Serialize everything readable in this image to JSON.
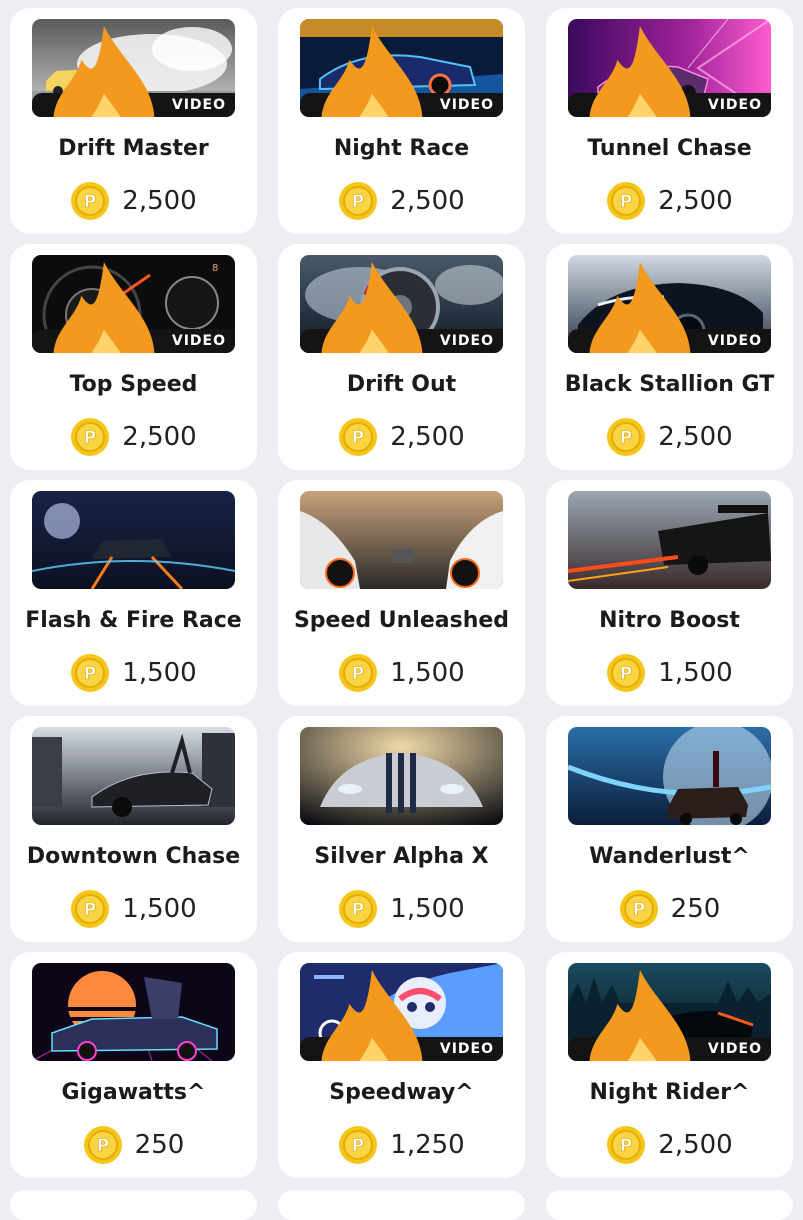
{
  "colors": {
    "card_bg": "#ffffff",
    "page_bg": "#eeeef2",
    "coin_gold": "#f5c518",
    "badge_bg": "#141414"
  },
  "items": [
    {
      "title": "Drift Master",
      "price": "2,500",
      "video": true,
      "badge": "VIDEO",
      "theme": "drift"
    },
    {
      "title": "Night Race",
      "price": "2,500",
      "video": true,
      "badge": "VIDEO",
      "theme": "neon-blue"
    },
    {
      "title": "Tunnel Chase",
      "price": "2,500",
      "video": true,
      "badge": "VIDEO",
      "theme": "tunnel"
    },
    {
      "title": "Top Speed",
      "price": "2,500",
      "video": true,
      "badge": "VIDEO",
      "theme": "gauge"
    },
    {
      "title": "Drift Out",
      "price": "2,500",
      "video": true,
      "badge": "VIDEO",
      "theme": "wheel"
    },
    {
      "title": "Black Stallion GT",
      "price": "2,500",
      "video": true,
      "badge": "VIDEO",
      "theme": "dark-car"
    },
    {
      "title": "Flash & Fire Race",
      "price": "1,500",
      "video": false,
      "badge": "",
      "theme": "fire-race"
    },
    {
      "title": "Speed Unleashed",
      "price": "1,500",
      "video": false,
      "badge": "",
      "theme": "street"
    },
    {
      "title": "Nitro Boost",
      "price": "1,500",
      "video": false,
      "badge": "",
      "theme": "nitro"
    },
    {
      "title": "Downtown Chase",
      "price": "1,500",
      "video": false,
      "badge": "",
      "theme": "city"
    },
    {
      "title": "Silver Alpha X",
      "price": "1,500",
      "video": false,
      "badge": "",
      "theme": "silver"
    },
    {
      "title": "Wanderlust^",
      "price": "250",
      "video": false,
      "badge": "",
      "theme": "planet"
    },
    {
      "title": "Gigawatts^",
      "price": "250",
      "video": false,
      "badge": "",
      "theme": "synthwave"
    },
    {
      "title": "Speedway^",
      "price": "1,250",
      "video": true,
      "badge": "VIDEO",
      "theme": "cartoon"
    },
    {
      "title": "Night Rider^",
      "price": "2,500",
      "video": true,
      "badge": "VIDEO",
      "theme": "night"
    }
  ]
}
